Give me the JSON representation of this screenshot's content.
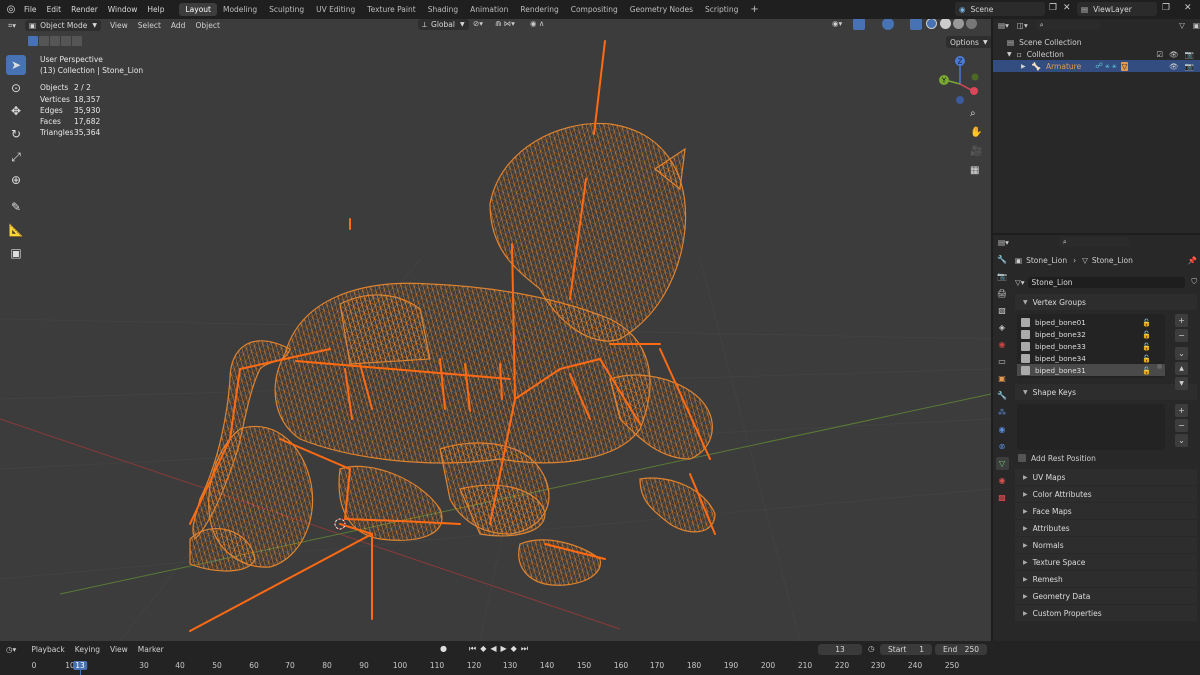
{
  "topbar": {
    "menus": [
      "File",
      "Edit",
      "Render",
      "Window",
      "Help"
    ],
    "workspaces": [
      "Layout",
      "Modeling",
      "Sculpting",
      "UV Editing",
      "Texture Paint",
      "Shading",
      "Animation",
      "Rendering",
      "Compositing",
      "Geometry Nodes",
      "Scripting"
    ],
    "active_workspace": "Layout",
    "add_tab": "+",
    "scene": "Scene",
    "view_layer": "ViewLayer"
  },
  "viewport": {
    "mode": "Object Mode",
    "menus": [
      "View",
      "Select",
      "Add",
      "Object"
    ],
    "transform_orientation": "Global",
    "options": "Options",
    "perspective": "User Perspective",
    "collection_line": "(13) Collection | Stone_Lion",
    "stats": [
      {
        "label": "Objects",
        "value": "2 / 2"
      },
      {
        "label": "Vertices",
        "value": "18,357"
      },
      {
        "label": "Edges",
        "value": "35,930"
      },
      {
        "label": "Faces",
        "value": "17,682"
      },
      {
        "label": "Triangles",
        "value": "35,364"
      }
    ],
    "gizmo_axes": {
      "x": "X",
      "y": "Y",
      "z": "Z"
    }
  },
  "outliner": {
    "scene_collection": "Scene Collection",
    "collection": "Collection",
    "armature": "Armature"
  },
  "properties": {
    "breadcrumb_object": "Stone_Lion",
    "breadcrumb_mesh": "Stone_Lion",
    "mesh_name": "Stone_Lion",
    "vertex_groups_title": "Vertex Groups",
    "vertex_groups": [
      "biped_bone01",
      "biped_bone32",
      "biped_bone33",
      "biped_bone34",
      "biped_bone31"
    ],
    "selected_vertex_group_index": 4,
    "shape_keys_title": "Shape Keys",
    "add_rest_position": "Add Rest Position",
    "collapsed_panels": [
      "UV Maps",
      "Color Attributes",
      "Face Maps",
      "Attributes",
      "Normals",
      "Texture Space",
      "Remesh",
      "Geometry Data",
      "Custom Properties"
    ]
  },
  "timeline": {
    "menus": [
      "Playback",
      "Keying",
      "View",
      "Marker"
    ],
    "current_frame": "13",
    "start_label": "Start",
    "start": "1",
    "end_label": "End",
    "end": "250",
    "ticks": [
      "0",
      "10",
      "13",
      "30",
      "40",
      "50",
      "60",
      "70",
      "80",
      "90",
      "100",
      "110",
      "120",
      "130",
      "140",
      "150",
      "160",
      "170",
      "180",
      "190",
      "200",
      "210",
      "220",
      "230",
      "240",
      "250"
    ]
  },
  "colors": {
    "wire": "#e8872f",
    "bone": "#ff6a12",
    "accent": "#4772b3",
    "viewport_bg": "#3c3c3c"
  }
}
